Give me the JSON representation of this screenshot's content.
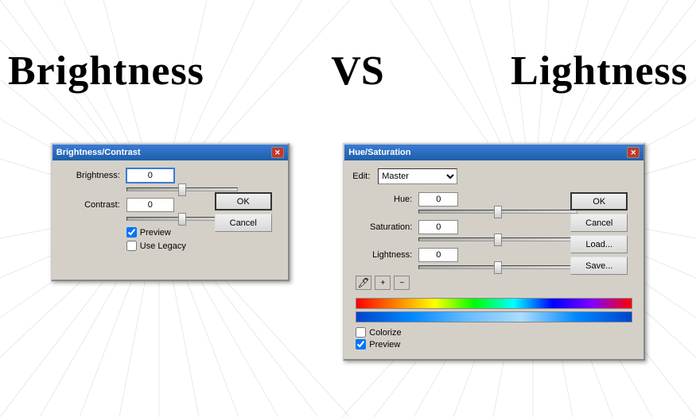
{
  "background": {
    "color": "#ffffff"
  },
  "titles": {
    "brightness": "Brightness",
    "vs": "VS",
    "lightness": "Lightness"
  },
  "brightness_dialog": {
    "title": "Brightness/Contrast",
    "brightness_label": "Brightness:",
    "brightness_value": "0",
    "contrast_label": "Contrast:",
    "contrast_value": "0",
    "ok_label": "OK",
    "cancel_label": "Cancel",
    "preview_label": "Preview",
    "use_legacy_label": "Use Legacy",
    "preview_checked": true,
    "use_legacy_checked": false
  },
  "hue_saturation_dialog": {
    "title": "Hue/Saturation",
    "edit_label": "Edit:",
    "edit_value": "Master",
    "hue_label": "Hue:",
    "hue_value": "0",
    "saturation_label": "Saturation:",
    "saturation_value": "0",
    "lightness_label": "Lightness:",
    "lightness_value": "0",
    "ok_label": "OK",
    "cancel_label": "Cancel",
    "load_label": "Load...",
    "save_label": "Save...",
    "colorize_label": "Colorize",
    "preview_label": "Preview",
    "colorize_checked": false,
    "preview_checked": true
  }
}
